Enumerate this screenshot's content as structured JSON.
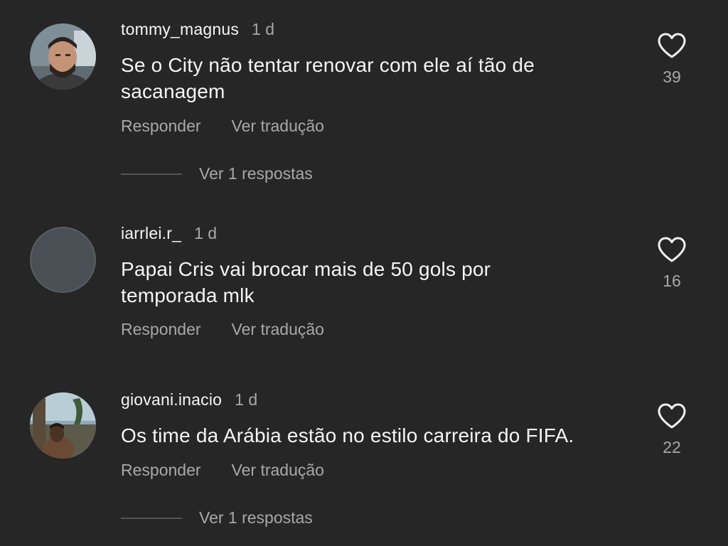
{
  "colors": {
    "background": "#262626",
    "primary_text": "#f5f5f5",
    "secondary_text": "#a8a8a8",
    "divider": "#555555"
  },
  "comments": [
    {
      "username": "tommy_magnus",
      "time": "1 d",
      "text_lines": [
        "Se o City não tentar renovar com ele aí tão de",
        "sacanagem"
      ],
      "reply_label": "Responder",
      "translate_label": "Ver tradução",
      "likes": "39",
      "like_icon": "heart-outline-icon",
      "replies_label": "Ver 1 respostas"
    },
    {
      "username": "iarrlei.r_",
      "time": "1 d",
      "text_lines": [
        "Papai Cris vai brocar mais de 50 gols por",
        "temporada mlk"
      ],
      "reply_label": "Responder",
      "translate_label": "Ver tradução",
      "likes": "16",
      "like_icon": "heart-outline-icon"
    },
    {
      "username": "giovani.inacio",
      "time": "1 d",
      "text_lines": [
        "Os time da Arábia estão no estilo carreira do FIFA."
      ],
      "reply_label": "Responder",
      "translate_label": "Ver tradução",
      "likes": "22",
      "like_icon": "heart-outline-icon",
      "replies_label": "Ver 1 respostas"
    }
  ]
}
